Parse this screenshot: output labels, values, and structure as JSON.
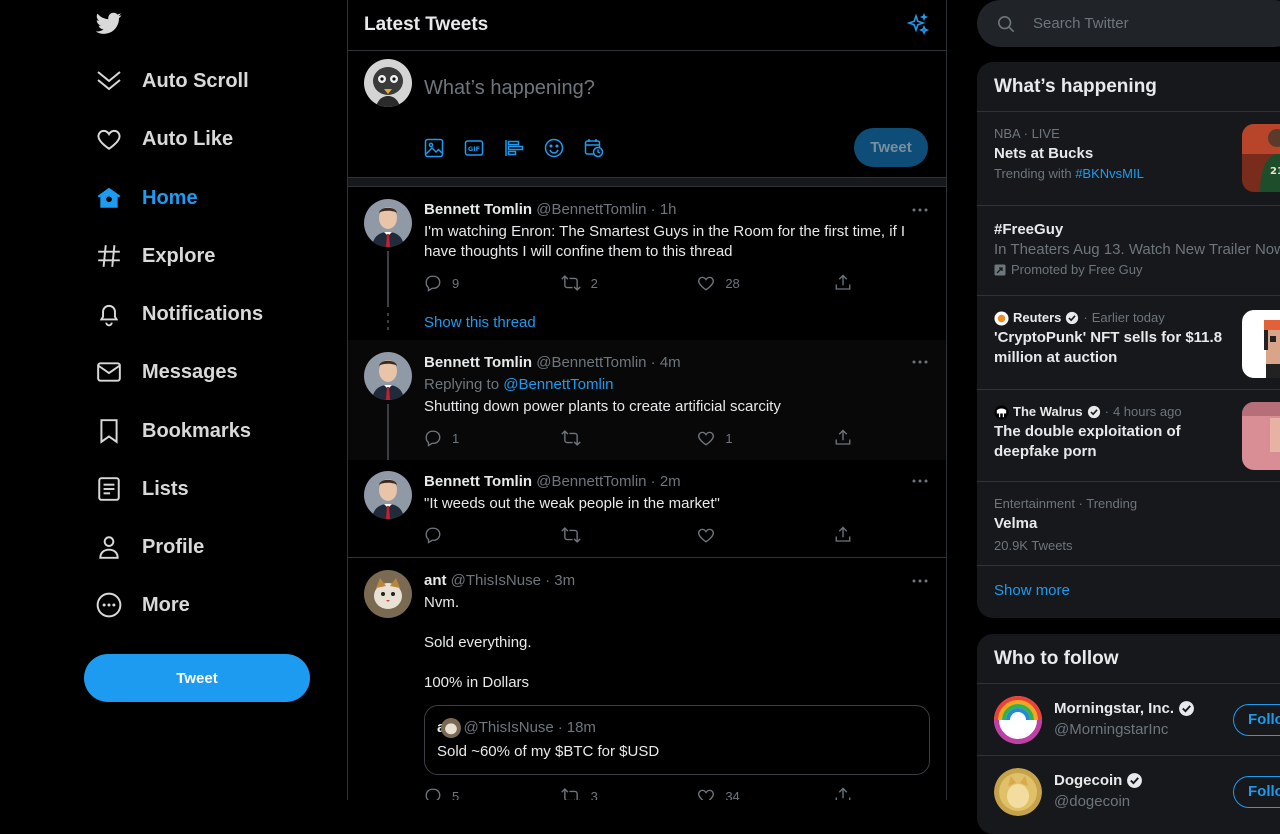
{
  "sidebar": {
    "items": [
      {
        "label": "Auto Scroll",
        "icon": "chevrons-down-icon"
      },
      {
        "label": "Auto Like",
        "icon": "heart-icon"
      },
      {
        "label": "Home",
        "icon": "home-icon",
        "active": true
      },
      {
        "label": "Explore",
        "icon": "hashtag-icon"
      },
      {
        "label": "Notifications",
        "icon": "bell-icon"
      },
      {
        "label": "Messages",
        "icon": "mail-icon"
      },
      {
        "label": "Bookmarks",
        "icon": "bookmark-icon"
      },
      {
        "label": "Lists",
        "icon": "list-icon"
      },
      {
        "label": "Profile",
        "icon": "person-icon"
      },
      {
        "label": "More",
        "icon": "more-circle-icon"
      }
    ],
    "tweet_button": "Tweet"
  },
  "main": {
    "title": "Latest Tweets",
    "composer": {
      "placeholder": "What’s happening?",
      "tweet_button": "Tweet"
    },
    "tweets": [
      {
        "name": "Bennett Tomlin",
        "handle": "@BennettTomlin",
        "time": "1h",
        "text": "I'm watching Enron: The Smartest Guys in the Room for the first time, if I have thoughts I will confine them to this thread",
        "replies": "9",
        "retweets": "2",
        "likes": "28",
        "show_thread": "Show this thread"
      },
      {
        "name": "Bennett Tomlin",
        "handle": "@BennettTomlin",
        "time": "4m",
        "replying_prefix": "Replying to",
        "replying_to": "@BennettTomlin",
        "text": "Shutting down power plants to create artificial scarcity",
        "replies": "1",
        "retweets": "",
        "likes": "1"
      },
      {
        "name": "Bennett Tomlin",
        "handle": "@BennettTomlin",
        "time": "2m",
        "text": "\"It weeds out the weak people in the market\"",
        "replies": "",
        "retweets": "",
        "likes": ""
      },
      {
        "name": "ant",
        "handle": "@ThisIsNuse",
        "time": "3m",
        "text_lines": [
          "Nvm.",
          "Sold everything.",
          "100% in Dollars"
        ],
        "quote": {
          "name": "ant",
          "handle": "@ThisIsNuse",
          "time": "18m",
          "text": "Sold ~60% of my $BTC for $USD"
        },
        "replies": "5",
        "retweets": "3",
        "likes": "34"
      }
    ]
  },
  "right": {
    "search_placeholder": "Search Twitter",
    "happening": {
      "title": "What’s happening",
      "trends": [
        {
          "meta": "NBA · LIVE",
          "headline": "Nets at Bucks",
          "sub_prefix": "Trending with",
          "sub_tag": "#BKNvsMIL"
        },
        {
          "headline": "#FreeGuy",
          "desc": "In Theaters Aug 13. Watch New Trailer Now",
          "promoted": "Promoted by Free Guy"
        },
        {
          "source": "Reuters",
          "meta": "Earlier today",
          "headline": "'CryptoPunk' NFT sells for $11.8 million at auction"
        },
        {
          "source": "The Walrus",
          "meta": "4 hours ago",
          "headline": "The double exploitation of deepfake porn"
        },
        {
          "meta": "Entertainment · Trending",
          "headline": "Velma",
          "count": "20.9K Tweets"
        }
      ],
      "show_more": "Show more"
    },
    "who_to_follow": {
      "title": "Who to follow",
      "accounts": [
        {
          "name": "Morningstar, Inc.",
          "handle": "@MorningstarInc",
          "button": "Follow"
        },
        {
          "name": "Dogecoin",
          "handle": "@dogecoin",
          "button": "Follow"
        }
      ]
    }
  },
  "colors": {
    "accent": "#1d9bf0",
    "background": "#000000",
    "panel": "#16181c",
    "border": "#2f3336",
    "muted": "#6e767d"
  }
}
